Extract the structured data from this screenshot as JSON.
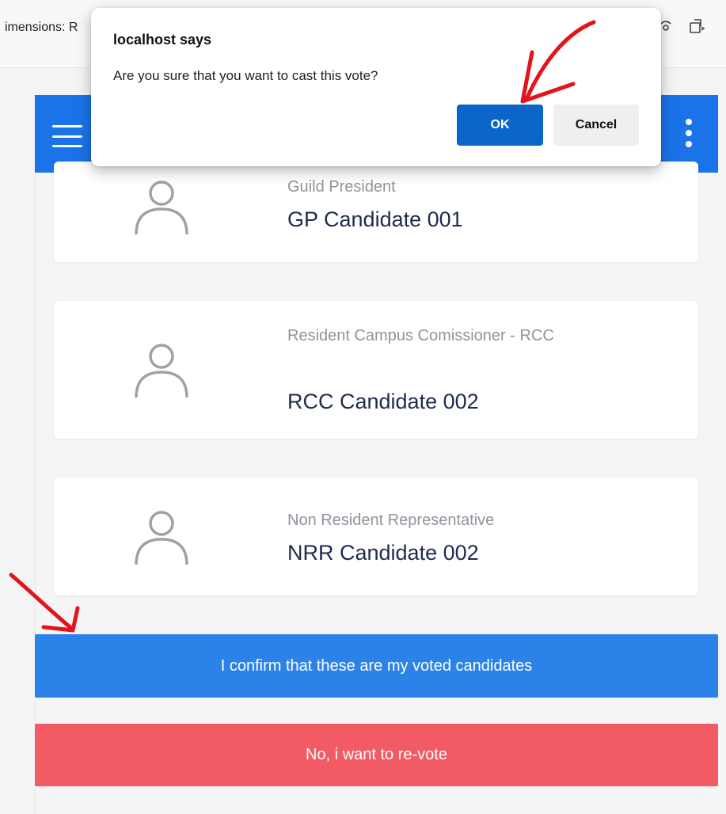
{
  "browser": {
    "devtools_label": "imensions: R"
  },
  "dialog": {
    "title": "localhost says",
    "message": "Are you sure that you want to cast this vote?",
    "ok_label": "OK",
    "cancel_label": "Cancel"
  },
  "candidates": [
    {
      "position": "Guild President",
      "name": "GP Candidate 001"
    },
    {
      "position": "Resident Campus Comissioner - RCC",
      "name": "RCC Candidate 002"
    },
    {
      "position": "Non Resident Representative",
      "name": "NRR Candidate 002"
    }
  ],
  "actions": {
    "confirm_label": "I confirm that these are my voted candidates",
    "revote_label": "No, i want to re-vote"
  },
  "colors": {
    "app_bar": "#1a73e8",
    "confirm": "#2b83ea",
    "revote": "#f25b64",
    "ok_button": "#0a66c8",
    "annotation": "#e3141b"
  },
  "icons": {
    "menu": "hamburger-menu-icon",
    "more": "more-vertical-icon",
    "avatar": "user-avatar-icon"
  }
}
